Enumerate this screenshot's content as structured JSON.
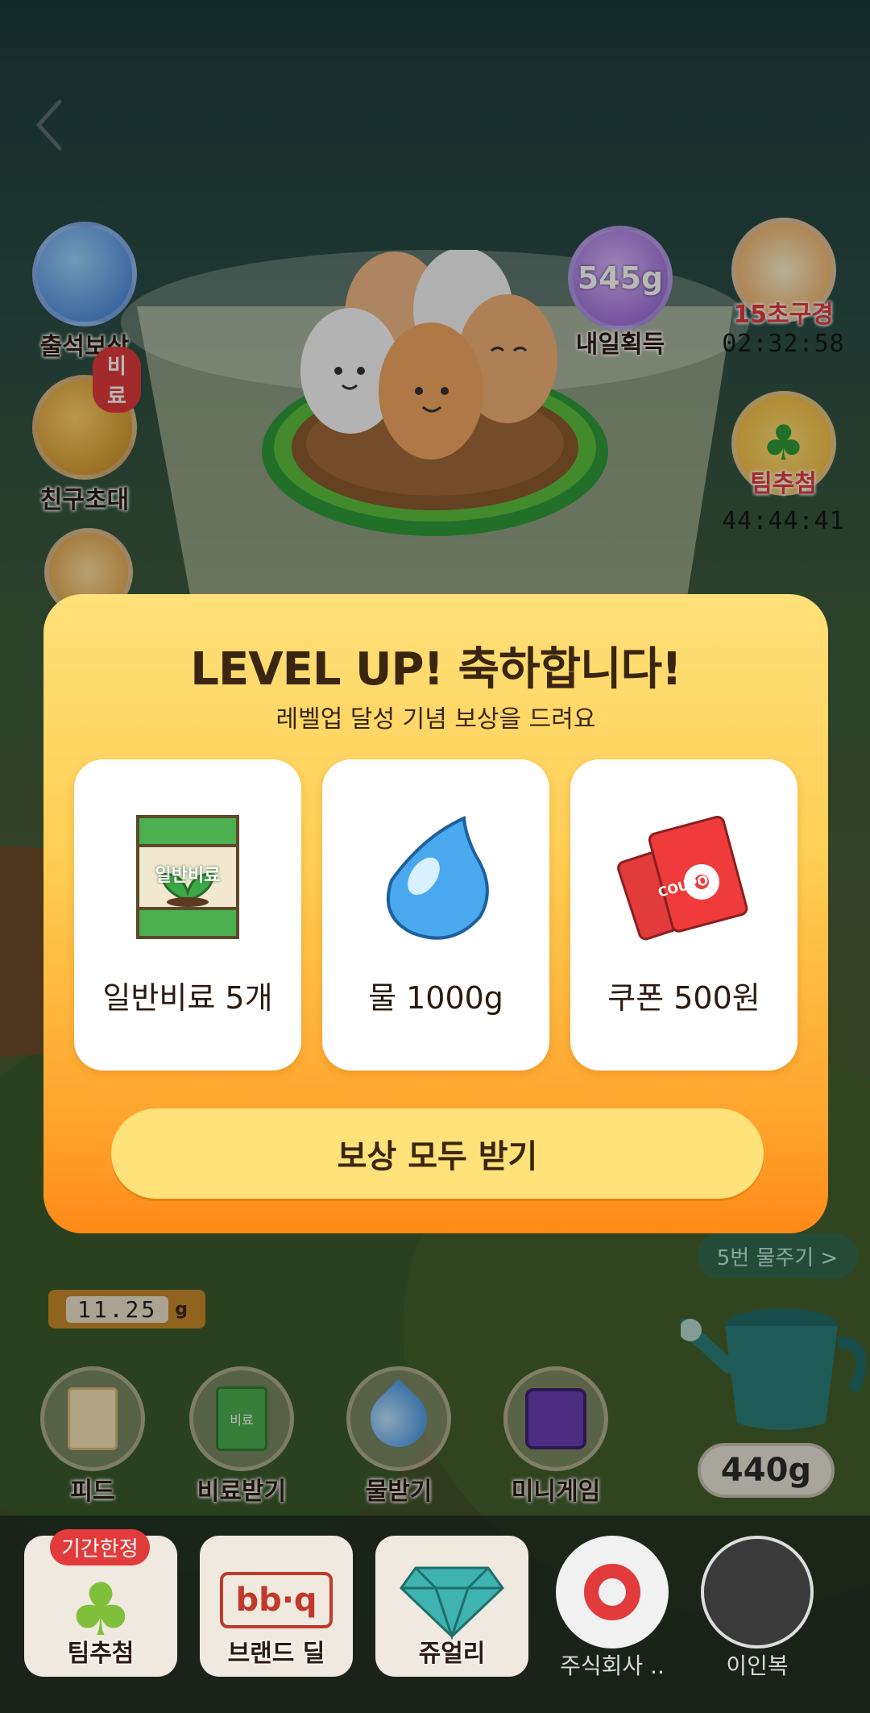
{
  "nav": {
    "back_icon": "chevron-left-icon"
  },
  "left_side": [
    {
      "label": "출석보상",
      "icon": "bottle-icon"
    },
    {
      "label": "친구초대",
      "icon": "treasure-chest-icon",
      "badge": "비료"
    },
    {
      "label": "",
      "icon": "roulette-icon"
    }
  ],
  "right_side": [
    {
      "label": "15초구경",
      "icon": "fertilizer-bags-icon",
      "timer": "02:32:58"
    },
    {
      "label": "팀추첨",
      "icon": "clover-icon",
      "timer": "44:44:41"
    }
  ],
  "top_center": {
    "amount": "545g",
    "label": "내일획득"
  },
  "modal": {
    "title": "LEVEL UP! 축하합니다!",
    "subtitle": "레벨업 달성 기념 보상을 드려요",
    "rewards": [
      {
        "label": "일반비료 5개",
        "icon": "fertilizer-bag-icon",
        "bag_text": "일반비료"
      },
      {
        "label": "물 1000g",
        "icon": "water-drop-icon"
      },
      {
        "label": "쿠폰 500원",
        "icon": "coupon-icon",
        "coupon_text": "COUPON"
      }
    ],
    "claim_label": "보상 모두 받기"
  },
  "tools": [
    {
      "label": "피드",
      "icon": "feed-icon"
    },
    {
      "label": "비료받기",
      "icon": "fertilizer-icon",
      "bag_text": "비료"
    },
    {
      "label": "물받기",
      "icon": "water-drop-icon"
    },
    {
      "label": "미니게임",
      "icon": "arcade-icon"
    }
  ],
  "counter": "11.25",
  "counter_unit": "g",
  "water_chip": "5번 물주기 >",
  "watering_can_amount": "440g",
  "bottom_shop": [
    {
      "label": "팀추첨",
      "icon": "clover-icon",
      "badge": "기간한정"
    },
    {
      "label": "브랜드 딜",
      "icon": "bbq-logo-icon",
      "logo_text": "bb·q"
    },
    {
      "label": "쥬얼리",
      "icon": "diamond-icon"
    },
    {
      "label": "주식회사 ..",
      "icon": "brand-logo-icon"
    },
    {
      "label": "이인복",
      "icon": "shop-photo-icon"
    }
  ],
  "colors": {
    "modal_top": "#ffe07a",
    "modal_bottom": "#ff8a18",
    "claim_button": "#ffe27a",
    "text_dark": "#3a2610"
  }
}
